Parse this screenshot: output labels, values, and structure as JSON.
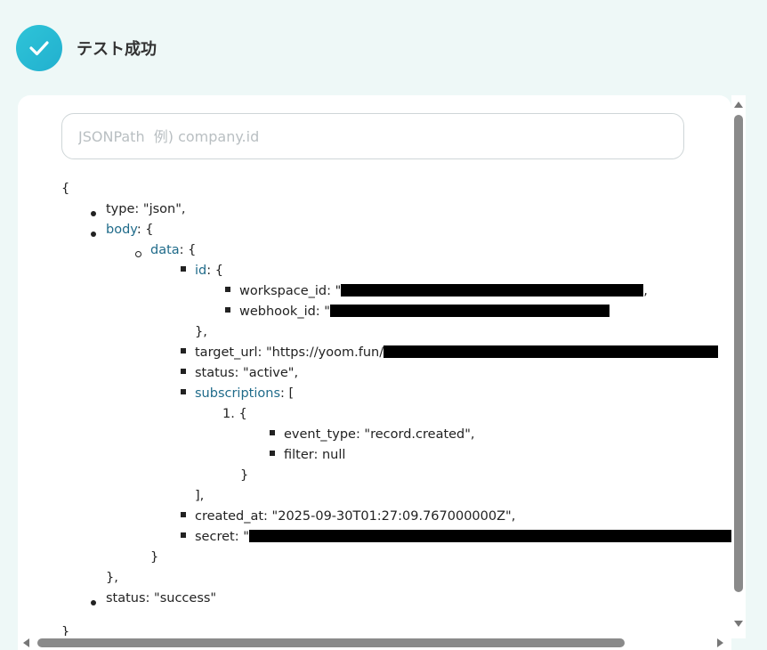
{
  "header": {
    "title": "テスト成功",
    "icon": "check-circle-icon",
    "accent": "#27bcd6"
  },
  "search": {
    "placeholder": "JSONPath  例) company.id",
    "value": ""
  },
  "tree": {
    "open_brace": "{",
    "type_key": "type",
    "type_value": ": \"json\",",
    "body_key": "body",
    "body_open": ": {",
    "data_key": "data",
    "data_open": ": {",
    "id_key": "id",
    "id_open": ": {",
    "workspace_id_key": "workspace_id: \"",
    "workspace_id_tail": ",",
    "webhook_id_key": "webhook_id: \"",
    "id_close": "},",
    "target_url_key": "target_url: \"https://yoom.fun/",
    "status_line": "status: \"active\",",
    "subscriptions_key": "subscriptions",
    "subscriptions_open": ": [",
    "list_index": "1.",
    "item_open": "{",
    "event_type_line": "event_type: \"record.created\",",
    "filter_line": "filter: null",
    "item_close": "}",
    "subscriptions_close": "],",
    "created_at_line": "created_at: \"2025-09-30T01:27:09.767000000Z\",",
    "secret_key": "secret: \"",
    "data_close": "}",
    "body_close": "},",
    "status_success_line": "status: \"success\"",
    "close_brace": "}"
  }
}
